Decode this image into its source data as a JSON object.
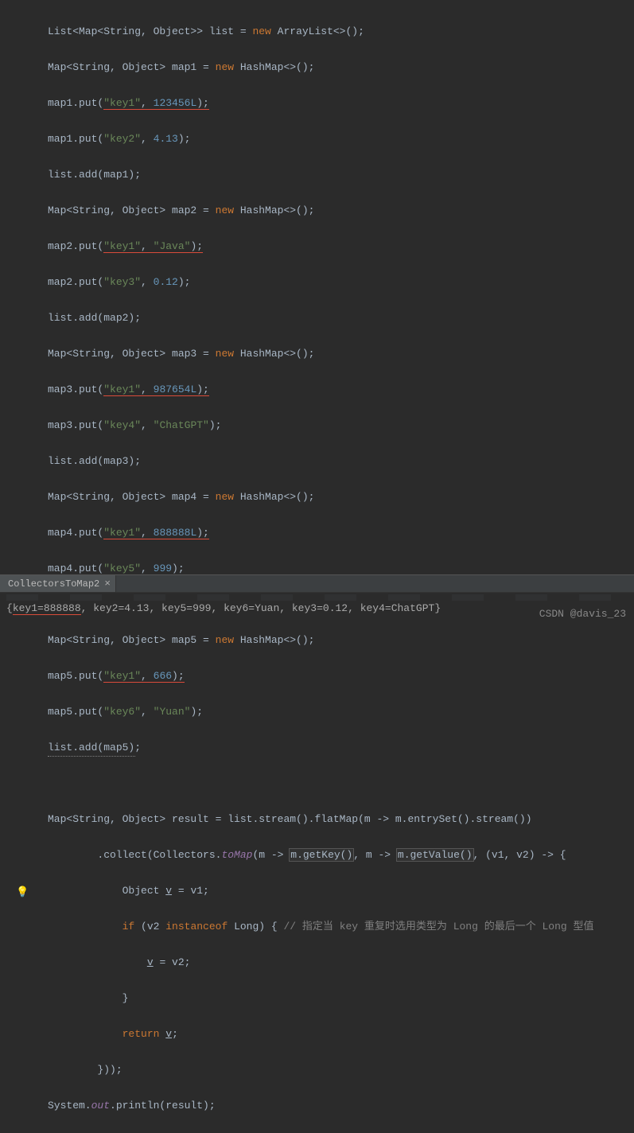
{
  "code": {
    "l1_a": "List<Map<String, Object>> list = ",
    "l1_new": "new",
    "l1_b": " ArrayList<>();",
    "l2_a": "Map<String, Object> map1 = ",
    "l2_new": "new",
    "l2_b": " HashMap<>();",
    "l3_a": "map1.put(",
    "l3_k": "\"key1\"",
    "l3_c": ", ",
    "l3_v": "123456L",
    "l3_e": ");",
    "l4_a": "map1.put(",
    "l4_k": "\"key2\"",
    "l4_c": ", ",
    "l4_v": "4.13",
    "l4_e": ");",
    "l5": "list.add(map1);",
    "l6_a": "Map<String, Object> map2 = ",
    "l6_new": "new",
    "l6_b": " HashMap<>();",
    "l7_a": "map2.put(",
    "l7_k": "\"key1\"",
    "l7_c": ", ",
    "l7_v": "\"Java\"",
    "l7_e": ");",
    "l8_a": "map2.put(",
    "l8_k": "\"key3\"",
    "l8_c": ", ",
    "l8_v": "0.12",
    "l8_e": ");",
    "l9": "list.add(map2);",
    "l10_a": "Map<String, Object> map3 = ",
    "l10_new": "new",
    "l10_b": " HashMap<>();",
    "l11_a": "map3.put(",
    "l11_k": "\"key1\"",
    "l11_c": ", ",
    "l11_v": "987654L",
    "l11_e": ");",
    "l12_a": "map3.put(",
    "l12_k": "\"key4\"",
    "l12_c": ", ",
    "l12_v": "\"ChatGPT\"",
    "l12_e": ");",
    "l13": "list.add(map3);",
    "l14_a": "Map<String, Object> map4 = ",
    "l14_new": "new",
    "l14_b": " HashMap<>();",
    "l15_a": "map4.put(",
    "l15_k": "\"key1\"",
    "l15_c": ", ",
    "l15_v": "888888L",
    "l15_e": ");",
    "l16_a": "map4.put(",
    "l16_k": "\"key5\"",
    "l16_c": ", ",
    "l16_v": "999",
    "l16_e": ");",
    "l17": "list.add(map4);",
    "l18_a": "Map<String, Object> map5 = ",
    "l18_new": "new",
    "l18_b": " HashMap<>();",
    "l19_a": "map5.put(",
    "l19_k": "\"key1\"",
    "l19_c": ", ",
    "l19_v": "666",
    "l19_e": ");",
    "l20_a": "map5.put(",
    "l20_k": "\"key6\"",
    "l20_c": ", ",
    "l20_v": "\"Yuan\"",
    "l20_e": ");",
    "l21": "list.add(map5);",
    "l23_a": "Map<String, Object> result = list.stream().flatMap(m -> m.entrySet().stream())",
    "l24_a": "        .collect(Collectors.",
    "l24_m": "toMap",
    "l24_b": "(m -> ",
    "l24_h1": "m.getKey()",
    "l24_c": ", m -> ",
    "l24_h2": "m.getValue()",
    "l24_d": ", (v1, v2) -> {",
    "l25_a": "            Object ",
    "l25_v": "v",
    "l25_b": " = v1;",
    "l26_a": "            ",
    "l26_if": "if",
    "l26_b": " (v2 ",
    "l26_io": "instanceof",
    "l26_c": " Long) { ",
    "l26_cm": "// 指定当 key 重复时选用类型为 Long 的最后一个 Long 型值",
    "l27_a": "                ",
    "l27_v": "v",
    "l27_b": " = v2;",
    "l28": "            }",
    "l29_a": "            ",
    "l29_r": "return",
    "l29_b": " ",
    "l29_v": "v",
    "l29_c": ";",
    "l30": "        }));",
    "l31_a": "System.",
    "l31_o": "out",
    "l31_b": ".println(result);"
  },
  "tab": {
    "name": "CollectorsToMap2",
    "close": "×"
  },
  "console": {
    "out_a": "{",
    "out_key1": "key1=888888",
    "out_b": ", key2=4.13, key5=999, key6=Yuan, key3=0.12, key4=ChatGPT}"
  },
  "watermark": "CSDN @davis_23"
}
